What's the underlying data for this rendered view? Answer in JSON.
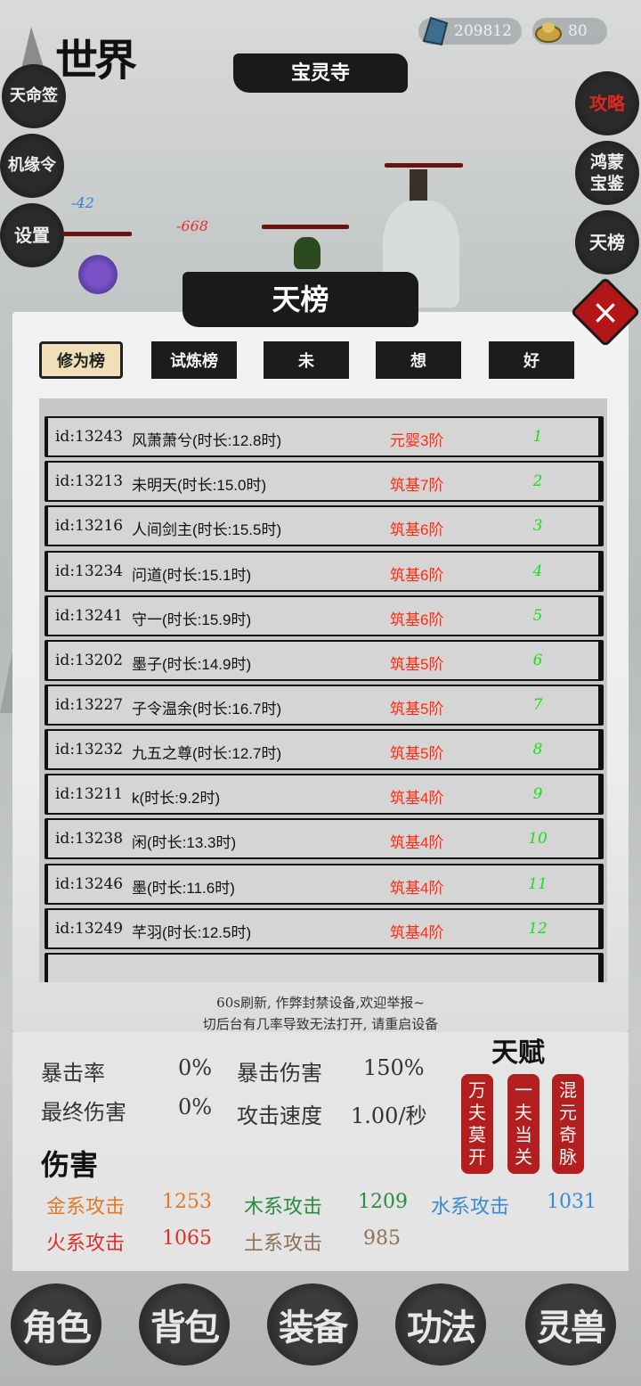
{
  "header": {
    "world_title": "世界",
    "location": "宝灵寺",
    "currency": [
      {
        "icon": "blue-crystal-icon",
        "value": "209812"
      },
      {
        "icon": "gold-ingot-icon",
        "value": "80"
      }
    ]
  },
  "left_menu": [
    "天命签",
    "机缘令",
    "设置"
  ],
  "right_menu": [
    {
      "label": "攻略",
      "color": "#e0281e"
    },
    {
      "label": "鸿蒙宝鉴",
      "color": "#eeeeee"
    },
    {
      "label": "天榜",
      "color": "#eeeeee"
    }
  ],
  "battle": {
    "damage": [
      "-42",
      "-668"
    ]
  },
  "modal": {
    "title": "天榜",
    "close_label": "×",
    "tabs": [
      {
        "label": "修为榜",
        "active": true
      },
      {
        "label": "试炼榜",
        "active": false
      },
      {
        "label": "未",
        "active": false
      },
      {
        "label": "想",
        "active": false
      },
      {
        "label": "好",
        "active": false
      }
    ],
    "rows": [
      {
        "id": "id:13243",
        "name": "风萧萧兮(时长:12.8时)",
        "rank": "元婴3阶",
        "num": "1"
      },
      {
        "id": "id:13213",
        "name": "未明天(时长:15.0时)",
        "rank": "筑基7阶",
        "num": "2"
      },
      {
        "id": "id:13216",
        "name": "人间剑主(时长:15.5时)",
        "rank": "筑基6阶",
        "num": "3"
      },
      {
        "id": "id:13234",
        "name": "问道(时长:15.1时)",
        "rank": "筑基6阶",
        "num": "4"
      },
      {
        "id": "id:13241",
        "name": "守一(时长:15.9时)",
        "rank": "筑基6阶",
        "num": "5"
      },
      {
        "id": "id:13202",
        "name": "墨子(时长:14.9时)",
        "rank": "筑基5阶",
        "num": "6"
      },
      {
        "id": "id:13227",
        "name": "子令温余(时长:16.7时)",
        "rank": "筑基5阶",
        "num": "7"
      },
      {
        "id": "id:13232",
        "name": "九五之尊(时长:12.7时)",
        "rank": "筑基5阶",
        "num": "8"
      },
      {
        "id": "id:13211",
        "name": "k(时长:9.2时)",
        "rank": "筑基4阶",
        "num": "9"
      },
      {
        "id": "id:13238",
        "name": "闲(时长:13.3时)",
        "rank": "筑基4阶",
        "num": "10"
      },
      {
        "id": "id:13246",
        "name": "墨(时长:11.6时)",
        "rank": "筑基4阶",
        "num": "11"
      },
      {
        "id": "id:13249",
        "name": "芊羽(时长:12.5时)",
        "rank": "筑基4阶",
        "num": "12"
      }
    ],
    "tip_line1": "60s刷新, 作弊封禁设备,欢迎举报~",
    "tip_line2": "切后台有几率导致无法打开, 请重启设备"
  },
  "stats": {
    "crit_rate_label": "暴击率",
    "crit_rate_value": "0%",
    "crit_dmg_label": "暴击伤害",
    "crit_dmg_value": "150%",
    "final_dmg_label": "最终伤害",
    "final_dmg_value": "0%",
    "atk_speed_label": "攻击速度",
    "atk_speed_value": "1.00/秒"
  },
  "talent": {
    "title": "天赋",
    "items": [
      "万夫莫开",
      "一夫当关",
      "混元奇脉"
    ]
  },
  "damage_section": {
    "title": "伤害",
    "attrs": [
      {
        "label": "金系攻击",
        "value": "1253",
        "color": "#e07a2a"
      },
      {
        "label": "木系攻击",
        "value": "1209",
        "color": "#2e8a3e"
      },
      {
        "label": "水系攻击",
        "value": "1031",
        "color": "#3a8ad0"
      },
      {
        "label": "火系攻击",
        "value": "1065",
        "color": "#d8302a"
      },
      {
        "label": "土系攻击",
        "value": "985",
        "color": "#8a7258"
      }
    ]
  },
  "bottom_nav": [
    "角色",
    "背包",
    "装备",
    "功法",
    "灵兽"
  ]
}
